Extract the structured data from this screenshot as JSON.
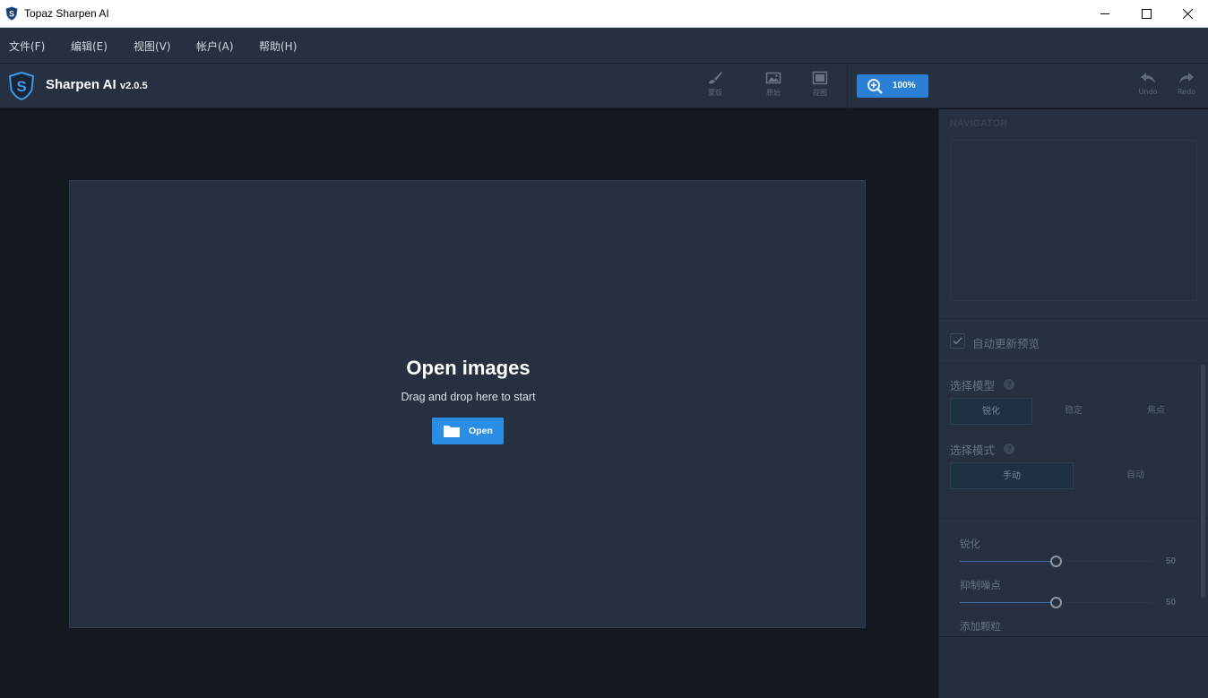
{
  "window": {
    "title": "Topaz Sharpen AI"
  },
  "menu": {
    "items": [
      "文件(F)",
      "编辑(E)",
      "视图(V)",
      "帐户(A)",
      "帮助(H)"
    ]
  },
  "toolbar": {
    "app_name": "Sharpen AI",
    "version": "v2.0.5",
    "tools": [
      {
        "label": "蒙版",
        "icon": "brush-icon"
      },
      {
        "label": "原始",
        "icon": "image-icon"
      },
      {
        "label": "视图",
        "icon": "view-icon"
      }
    ],
    "zoom_label": "100%",
    "undo_label": "Undo",
    "redo_label": "Redo"
  },
  "canvas": {
    "title": "Open images",
    "subtitle": "Drag and drop here to start",
    "open_button": "Open"
  },
  "panel": {
    "navigator_title": "NAVIGATOR",
    "auto_update_label": "自动更新预览",
    "auto_update_checked": true,
    "model_label": "选择模型",
    "model_options": [
      "锐化",
      "稳定",
      "焦点"
    ],
    "model_selected": "锐化",
    "mode_label": "选择模式",
    "mode_options": [
      "手动",
      "自动"
    ],
    "mode_selected": "手动",
    "sliders": [
      {
        "label": "锐化",
        "value": "50"
      },
      {
        "label": "抑制噪点",
        "value": "50"
      }
    ],
    "grain_label": "添加颗粒",
    "help_glyph": "?"
  },
  "colors": {
    "accent": "#2a8ee6",
    "panel_bg": "#263041",
    "canvas_bg": "#131821"
  }
}
